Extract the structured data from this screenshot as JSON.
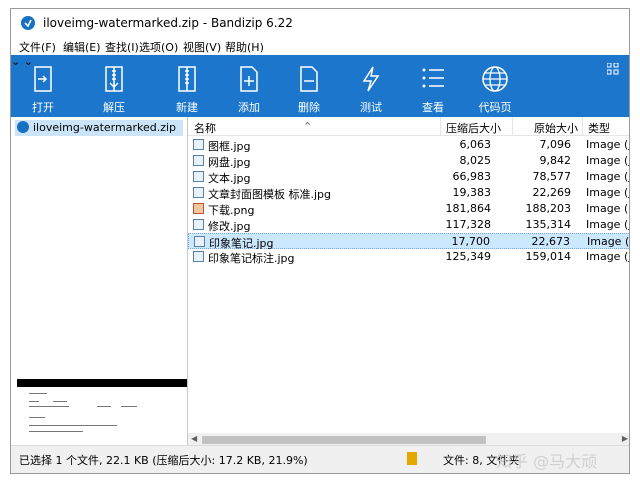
{
  "window": {
    "title": "iloveimg-watermarked.zip - Bandizip 6.22"
  },
  "menu": [
    "文件(F)",
    "编辑(E)",
    "查找(I)",
    "选项(O)",
    "视图(V)",
    "帮助(H)"
  ],
  "toolbar": {
    "open": "打开",
    "extract": "解压",
    "new": "新建",
    "add": "添加",
    "delete": "删除",
    "test": "测试",
    "view": "查看",
    "codepage": "代码页"
  },
  "tree": {
    "archive": "iloveimg-watermarked.zip"
  },
  "columns": {
    "name": "名称",
    "compressed": "压缩后大小",
    "original": "原始大小",
    "type": "类型"
  },
  "files": [
    {
      "name": "图框.jpg",
      "compressed": "6,063",
      "original": "7,096",
      "type": "Image (jpg"
    },
    {
      "name": "网盘.jpg",
      "compressed": "8,025",
      "original": "9,842",
      "type": "Image (jpg"
    },
    {
      "name": "文本.jpg",
      "compressed": "66,983",
      "original": "78,577",
      "type": "Image (jpg"
    },
    {
      "name": "文章封面图模板 标准.jpg",
      "compressed": "19,383",
      "original": "22,269",
      "type": "Image (jpg"
    },
    {
      "name": "下载.png",
      "compressed": "181,864",
      "original": "188,203",
      "type": "Image (png"
    },
    {
      "name": "修改.jpg",
      "compressed": "117,328",
      "original": "135,314",
      "type": "Image (jpg"
    },
    {
      "name": "印象笔记.jpg",
      "compressed": "17,700",
      "original": "22,673",
      "type": "Image (jpg"
    },
    {
      "name": "印象笔记标注.jpg",
      "compressed": "125,349",
      "original": "159,014",
      "type": "Image (jpg"
    }
  ],
  "status": {
    "left": "已选择 1 个文件, 22.1 KB (压缩后大小: 17.2 KB, 21.9%)",
    "right": "文件: 8, 文件夹"
  },
  "watermark": "知乎 @马大顽",
  "colors": {
    "toolbar": "#1b76cc",
    "selection": "#cce8ff"
  }
}
